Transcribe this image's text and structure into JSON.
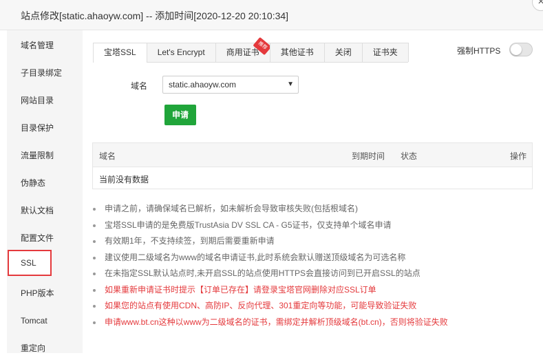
{
  "window": {
    "title": "站点修改[static.ahaoyw.com] -- 添加时间[2020-12-20 20:10:34]",
    "close_glyph": "×"
  },
  "sidebar": {
    "items": [
      {
        "label": "域名管理"
      },
      {
        "label": "子目录绑定"
      },
      {
        "label": "网站目录"
      },
      {
        "label": "目录保护"
      },
      {
        "label": "流量限制"
      },
      {
        "label": "伪静态"
      },
      {
        "label": "默认文档"
      },
      {
        "label": "配置文件"
      },
      {
        "label": "SSL"
      },
      {
        "label": "PHP版本"
      },
      {
        "label": "Tomcat"
      },
      {
        "label": "重定向"
      }
    ],
    "active": "SSL"
  },
  "tabs": [
    {
      "label": "宝塔SSL"
    },
    {
      "label": "Let's Encrypt"
    },
    {
      "label": "商用证书",
      "badge": "推荐"
    },
    {
      "label": "其他证书"
    },
    {
      "label": "关闭"
    },
    {
      "label": "证书夹"
    }
  ],
  "force_https": {
    "label": "强制HTTPS",
    "enabled": false
  },
  "form": {
    "domain_label": "域名",
    "domain_value": "static.ahaoyw.com",
    "apply_label": "申请"
  },
  "table": {
    "columns": {
      "domain": "域名",
      "expiry": "到期时间",
      "status": "状态",
      "actions": "操作"
    },
    "empty_text": "当前没有数据"
  },
  "tips": [
    {
      "text": "申请之前，请确保域名已解析，如未解析会导致审核失败(包括根域名)",
      "red": false
    },
    {
      "text": "宝塔SSL申请的是免费版TrustAsia DV SSL CA - G5证书，仅支持单个域名申请",
      "red": false
    },
    {
      "text": "有效期1年，不支持续签，到期后需要重新申请",
      "red": false
    },
    {
      "text": "建议使用二级域名为www的域名申请证书,此时系统会默认赠送顶级域名为可选名称",
      "red": false
    },
    {
      "text": "在未指定SSL默认站点时,未开启SSL的站点使用HTTPS会直接访问到已开启SSL的站点",
      "red": false
    },
    {
      "text": "如果重新申请证书时提示【订单已存在】请登录宝塔官网删除对应SSL订单",
      "red": true
    },
    {
      "text": "如果您的站点有使用CDN、高防IP、反向代理、301重定向等功能，可能导致验证失败",
      "red": true
    },
    {
      "text": "申请www.bt.cn这种以www为二级域名的证书，需绑定并解析顶级域名(bt.cn)，否则将验证失败",
      "red": true
    }
  ],
  "colors": {
    "accent_green": "#20a53a",
    "highlight_red": "#e4393c"
  }
}
